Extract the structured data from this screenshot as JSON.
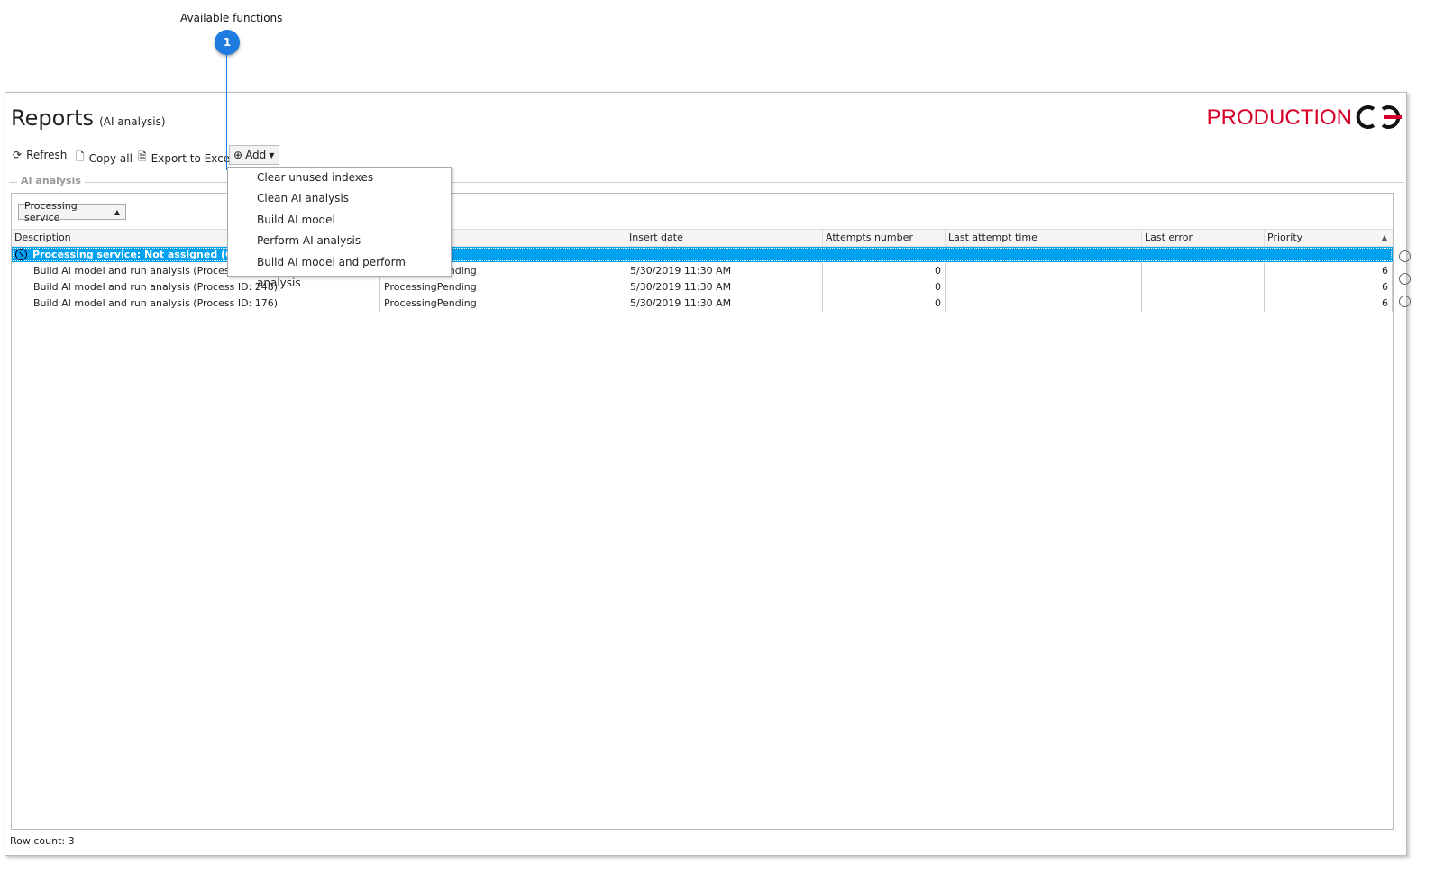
{
  "callout": {
    "label": "Available functions",
    "number": "1"
  },
  "header": {
    "title": "Reports",
    "subtitle": "(AI analysis)",
    "environment": "PRODUCTION",
    "env_color": "#d6002a"
  },
  "toolbar": {
    "refresh": "Refresh",
    "copy_all": "Copy all",
    "export": "Export to Excel",
    "add": "Add"
  },
  "add_menu": [
    "Clear unused indexes",
    "Clean AI analysis",
    "Build AI model",
    "Perform AI analysis",
    "Build AI model and perform analysis"
  ],
  "group_label": "AI analysis",
  "groupby": "Processing service",
  "columns": [
    "Description",
    "",
    "Insert date",
    "Attempts number",
    "Last attempt time",
    "Last error",
    "Priority"
  ],
  "group_row": "Processing service: Not assigned (Count",
  "rows": [
    {
      "description": "Build AI model and run analysis (Process ID: 1",
      "status": "ProcessingPending",
      "insert_date": "5/30/2019 11:30 AM",
      "attempts": "0",
      "last_attempt": "",
      "last_error": "",
      "priority": "6"
    },
    {
      "description": "Build AI model and run analysis (Process ID: 248)",
      "status": "ProcessingPending",
      "insert_date": "5/30/2019 11:30 AM",
      "attempts": "0",
      "last_attempt": "",
      "last_error": "",
      "priority": "6"
    },
    {
      "description": "Build AI model and run analysis (Process ID: 176)",
      "status": "ProcessingPending",
      "insert_date": "5/30/2019 11:30 AM",
      "attempts": "0",
      "last_attempt": "",
      "last_error": "",
      "priority": "6"
    }
  ],
  "status_bar": "Row count: 3",
  "accent": "#00a2f0"
}
